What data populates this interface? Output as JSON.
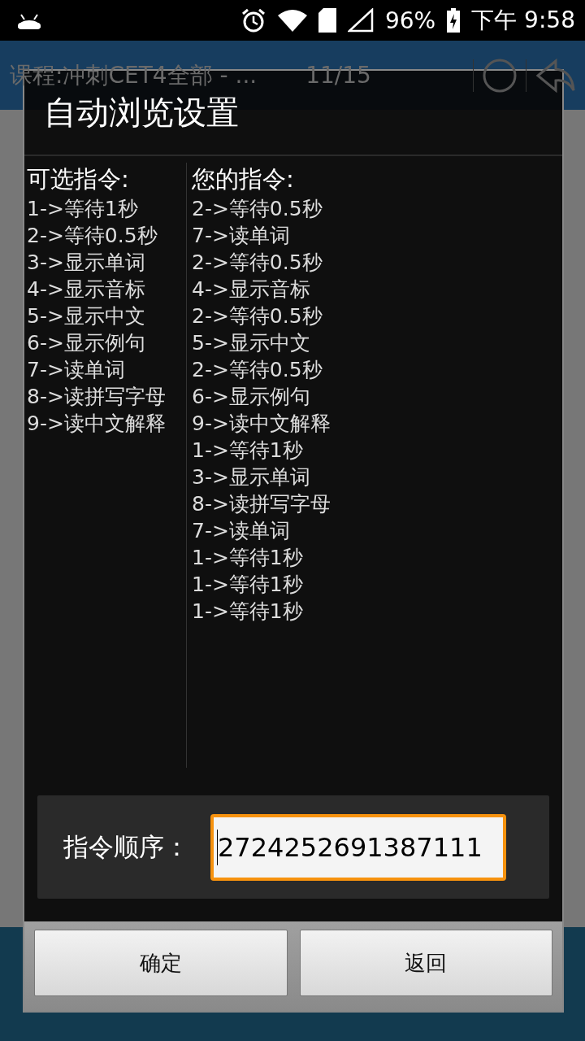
{
  "status_bar": {
    "battery": "96%",
    "time": "下午 9:58"
  },
  "app_header": {
    "title": "课程:冲刺CET4全部 - ...",
    "count": "11/15"
  },
  "dialog": {
    "title": "自动浏览设置",
    "available": {
      "heading": "可选指令:",
      "items": [
        "1->等待1秒",
        "2->等待0.5秒",
        "3->显示单词",
        "4->显示音标",
        "5->显示中文",
        "6->显示例句",
        "7->读单词",
        "8->读拼写字母",
        "9->读中文解释"
      ]
    },
    "yours": {
      "heading": "您的指令:",
      "items": [
        "2->等待0.5秒",
        "7->读单词",
        "2->等待0.5秒",
        "4->显示音标",
        "2->等待0.5秒",
        "5->显示中文",
        "2->等待0.5秒",
        "6->显示例句",
        "9->读中文解释",
        "1->等待1秒",
        "3->显示单词",
        "8->读拼写字母",
        "7->读单词",
        "1->等待1秒",
        "1->等待1秒",
        "1->等待1秒"
      ]
    },
    "order": {
      "label": "指令顺序：",
      "value": "2724252691387111"
    },
    "buttons": [
      "确定",
      "返回"
    ]
  }
}
